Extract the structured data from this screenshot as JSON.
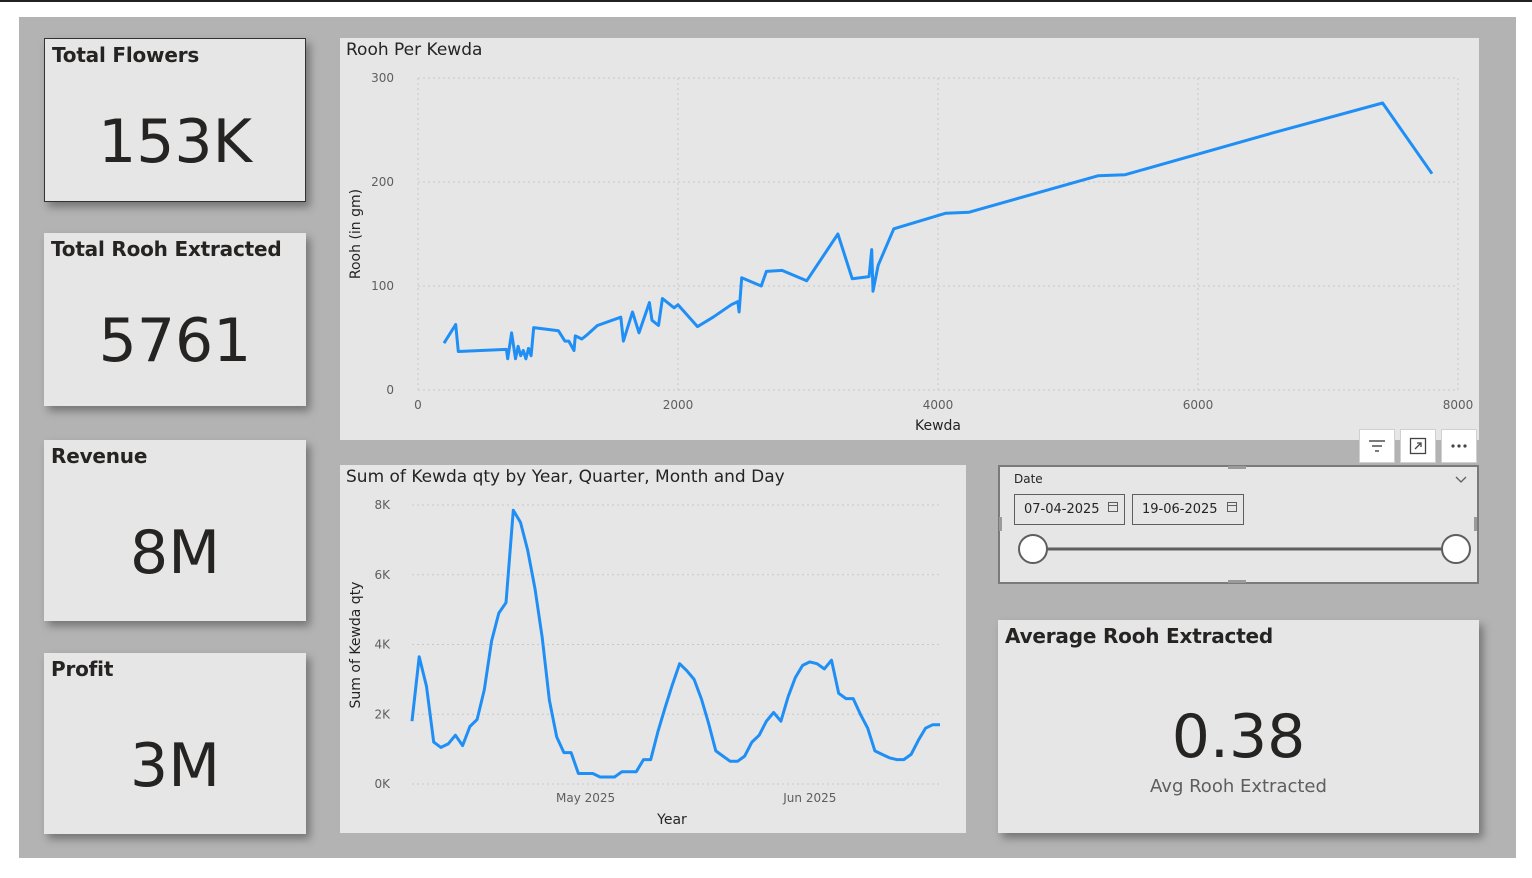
{
  "kpis": {
    "total_flowers": {
      "label": "Total Flowers",
      "value": "153K"
    },
    "total_rooh": {
      "label": "Total Rooh Extracted",
      "value": "5761"
    },
    "revenue": {
      "label": "Revenue",
      "value": "8M"
    },
    "profit": {
      "label": "Profit",
      "value": "3M"
    },
    "average_rooh": {
      "label": "Average Rooh Extracted",
      "value": "0.38",
      "sublabel": "Avg Rooh Extracted"
    }
  },
  "slicer": {
    "label": "Date",
    "start_date": "07-04-2025",
    "end_date": "19-06-2025",
    "range_fraction": [
      0.0,
      1.0
    ]
  },
  "toolbar": {
    "icons": [
      "filter-icon",
      "focus-mode-icon",
      "more-options-icon"
    ]
  },
  "colors": {
    "line": "#1f8ff5",
    "card_bg": "#e6e6e6",
    "canvas_bg": "#b3b3b3"
  },
  "chart_data": [
    {
      "id": "rooh_per_kewda",
      "type": "line",
      "title": "Rooh Per Kewda",
      "xlabel": "Kewda",
      "ylabel": "Rooh (in gm)",
      "xlim": [
        0,
        8000
      ],
      "ylim": [
        0,
        300
      ],
      "x_ticks": [
        "0",
        "2000",
        "4000",
        "6000",
        "8000"
      ],
      "y_ticks": [
        "0",
        "100",
        "200",
        "300"
      ],
      "grid": true,
      "x": [
        200,
        290,
        310,
        680,
        690,
        720,
        750,
        770,
        790,
        810,
        830,
        850,
        870,
        890,
        1080,
        1130,
        1160,
        1200,
        1210,
        1260,
        1300,
        1380,
        1560,
        1580,
        1650,
        1700,
        1780,
        1800,
        1850,
        1880,
        1970,
        2000,
        2150,
        2270,
        2410,
        2460,
        2470,
        2490,
        2640,
        2680,
        2800,
        2990,
        3230,
        3340,
        3470,
        3490,
        3500,
        3540,
        3660,
        4060,
        4240,
        5230,
        5440,
        6570,
        7420,
        7800
      ],
      "y": [
        45,
        63,
        37,
        39,
        30,
        55,
        30,
        42,
        33,
        38,
        30,
        40,
        33,
        60,
        57,
        47,
        47,
        38,
        52,
        49,
        53,
        62,
        70,
        47,
        75,
        55,
        84,
        67,
        62,
        88,
        79,
        82,
        61,
        70,
        82,
        85,
        75,
        108,
        100,
        114,
        115,
        105,
        150,
        107,
        109,
        135,
        95,
        120,
        155,
        170,
        171,
        206,
        207,
        247,
        276,
        208
      ]
    },
    {
      "id": "kewda_qty_by_date",
      "type": "line",
      "title": "Sum of Kewda qty by Year, Quarter, Month and Day",
      "xlabel": "Year",
      "ylabel": "Sum of Kewda qty",
      "ylim": [
        0,
        8000
      ],
      "y_ticks": [
        "0K",
        "2K",
        "4K",
        "6K",
        "8K"
      ],
      "x_tick_labels": [
        "May 2025",
        "Jun 2025"
      ],
      "grid": true,
      "x": [
        "2025-04-07",
        "2025-04-08",
        "2025-04-09",
        "2025-04-10",
        "2025-04-11",
        "2025-04-12",
        "2025-04-13",
        "2025-04-14",
        "2025-04-15",
        "2025-04-16",
        "2025-04-17",
        "2025-04-18",
        "2025-04-19",
        "2025-04-20",
        "2025-04-21",
        "2025-04-22",
        "2025-04-23",
        "2025-04-24",
        "2025-04-25",
        "2025-04-26",
        "2025-04-27",
        "2025-04-28",
        "2025-04-29",
        "2025-04-30",
        "2025-05-01",
        "2025-05-02",
        "2025-05-03",
        "2025-05-04",
        "2025-05-05",
        "2025-05-06",
        "2025-05-07",
        "2025-05-08",
        "2025-05-09",
        "2025-05-10",
        "2025-05-11",
        "2025-05-12",
        "2025-05-13",
        "2025-05-14",
        "2025-05-15",
        "2025-05-16",
        "2025-05-17",
        "2025-05-18",
        "2025-05-19",
        "2025-05-20",
        "2025-05-21",
        "2025-05-22",
        "2025-05-23",
        "2025-05-24",
        "2025-05-25",
        "2025-05-26",
        "2025-05-27",
        "2025-05-28",
        "2025-05-29",
        "2025-05-30",
        "2025-05-31",
        "2025-06-01",
        "2025-06-02",
        "2025-06-03",
        "2025-06-04",
        "2025-06-05",
        "2025-06-06",
        "2025-06-07",
        "2025-06-08",
        "2025-06-09",
        "2025-06-10",
        "2025-06-11",
        "2025-06-12",
        "2025-06-13",
        "2025-06-14",
        "2025-06-15",
        "2025-06-16",
        "2025-06-17",
        "2025-06-18",
        "2025-06-19"
      ],
      "y": [
        1800,
        3650,
        2800,
        1200,
        1050,
        1150,
        1400,
        1100,
        1650,
        1850,
        2700,
        4100,
        4900,
        5200,
        7850,
        7500,
        6700,
        5600,
        4200,
        2400,
        1350,
        900,
        900,
        300,
        300,
        300,
        200,
        200,
        200,
        350,
        350,
        350,
        700,
        700,
        1500,
        2200,
        2850,
        3450,
        3250,
        3000,
        2450,
        1750,
        950,
        800,
        650,
        650,
        800,
        1200,
        1400,
        1800,
        2050,
        1800,
        2500,
        3050,
        3400,
        3500,
        3450,
        3300,
        3550,
        2600,
        2450,
        2450,
        2000,
        1600,
        950,
        850,
        750,
        700,
        700,
        850,
        1250,
        1600,
        1700,
        1700
      ]
    }
  ]
}
